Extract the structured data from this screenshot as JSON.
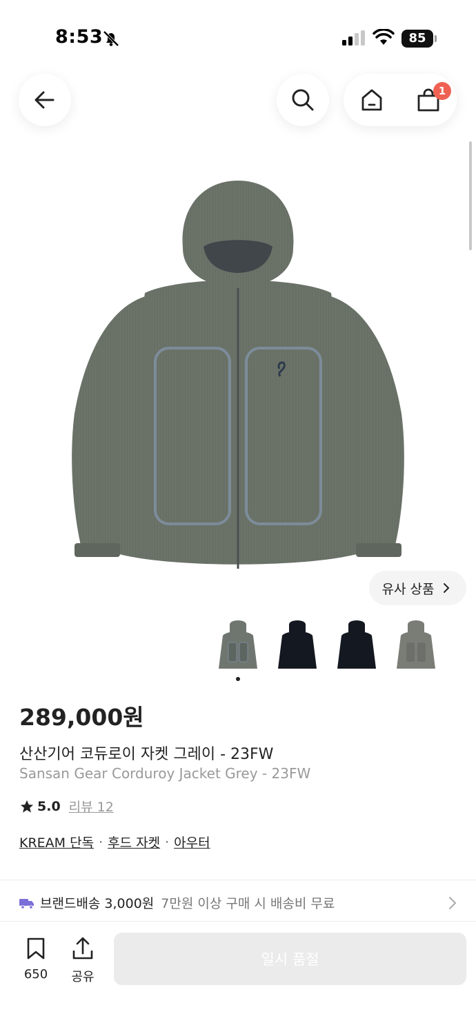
{
  "status_bar": {
    "time": "8:53",
    "battery": "85"
  },
  "header": {
    "back_icon": "arrow-left-icon",
    "search_icon": "search-icon",
    "home_icon": "home-icon",
    "cart_icon": "shopping-bag-icon",
    "cart_badge": "1"
  },
  "product": {
    "image_description_icon": "jacket-image",
    "similar_label": "유사 상품",
    "thumbnails": [
      {
        "name": "grey"
      },
      {
        "name": "black-1"
      },
      {
        "name": "black-2"
      },
      {
        "name": "grey-2"
      }
    ],
    "price": "289,000원",
    "name_ko": "산산기어 코듀로이 자켓 그레이  - 23FW",
    "name_en": "Sansan Gear Corduroy Jacket Grey  - 23FW",
    "rating": "5.0",
    "review_label": "리뷰 12",
    "tags": [
      "KREAM 단독",
      "후드 자켓",
      "아우터"
    ],
    "tag_separator": "·"
  },
  "shipping": {
    "label": "브랜드배송",
    "price": "3,000원",
    "note": "7만원 이상 구매 시 배송비 무료"
  },
  "bottom_bar": {
    "save_count": "650",
    "share_label": "공유",
    "buy_label": "일시 품절"
  },
  "colors": {
    "accent_badge": "#ef6253",
    "truck": "#7b6fd8",
    "jacket": "#6b7369"
  }
}
